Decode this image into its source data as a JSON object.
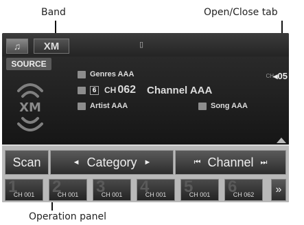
{
  "callouts": {
    "band": "Band",
    "open_close_tab": "Open/Close tab",
    "operation_panel": "Operation panel"
  },
  "tabs": [
    {
      "name": "music-tab",
      "icon": "music-note-icon",
      "label": "♫"
    },
    {
      "name": "xm-tab",
      "label": "XM"
    }
  ],
  "status_icon": "phone-status-icon",
  "source": {
    "label": "SOURCE"
  },
  "now_playing": {
    "genre": "Genres AAA",
    "preset": "6",
    "channel_prefix": "CH",
    "channel_number": "062",
    "channel_name": "Channel AAA",
    "artist": "Artist AAA",
    "song": "Song AAA"
  },
  "right_channel": {
    "prefix": "CH",
    "value": "05"
  },
  "operation_panel": {
    "scan": "Scan",
    "category": "Category",
    "channel": "Channel"
  },
  "presets": [
    {
      "num": "1",
      "label": "CH 001"
    },
    {
      "num": "2",
      "label": "CH 001"
    },
    {
      "num": "3",
      "label": "CH 001"
    },
    {
      "num": "4",
      "label": "CH 001"
    },
    {
      "num": "5",
      "label": "CH 001"
    },
    {
      "num": "6",
      "label": "CH 062"
    }
  ],
  "colors": {
    "screen_bg": "#1c1c1c",
    "panel_bg": "#b9b9b9"
  }
}
